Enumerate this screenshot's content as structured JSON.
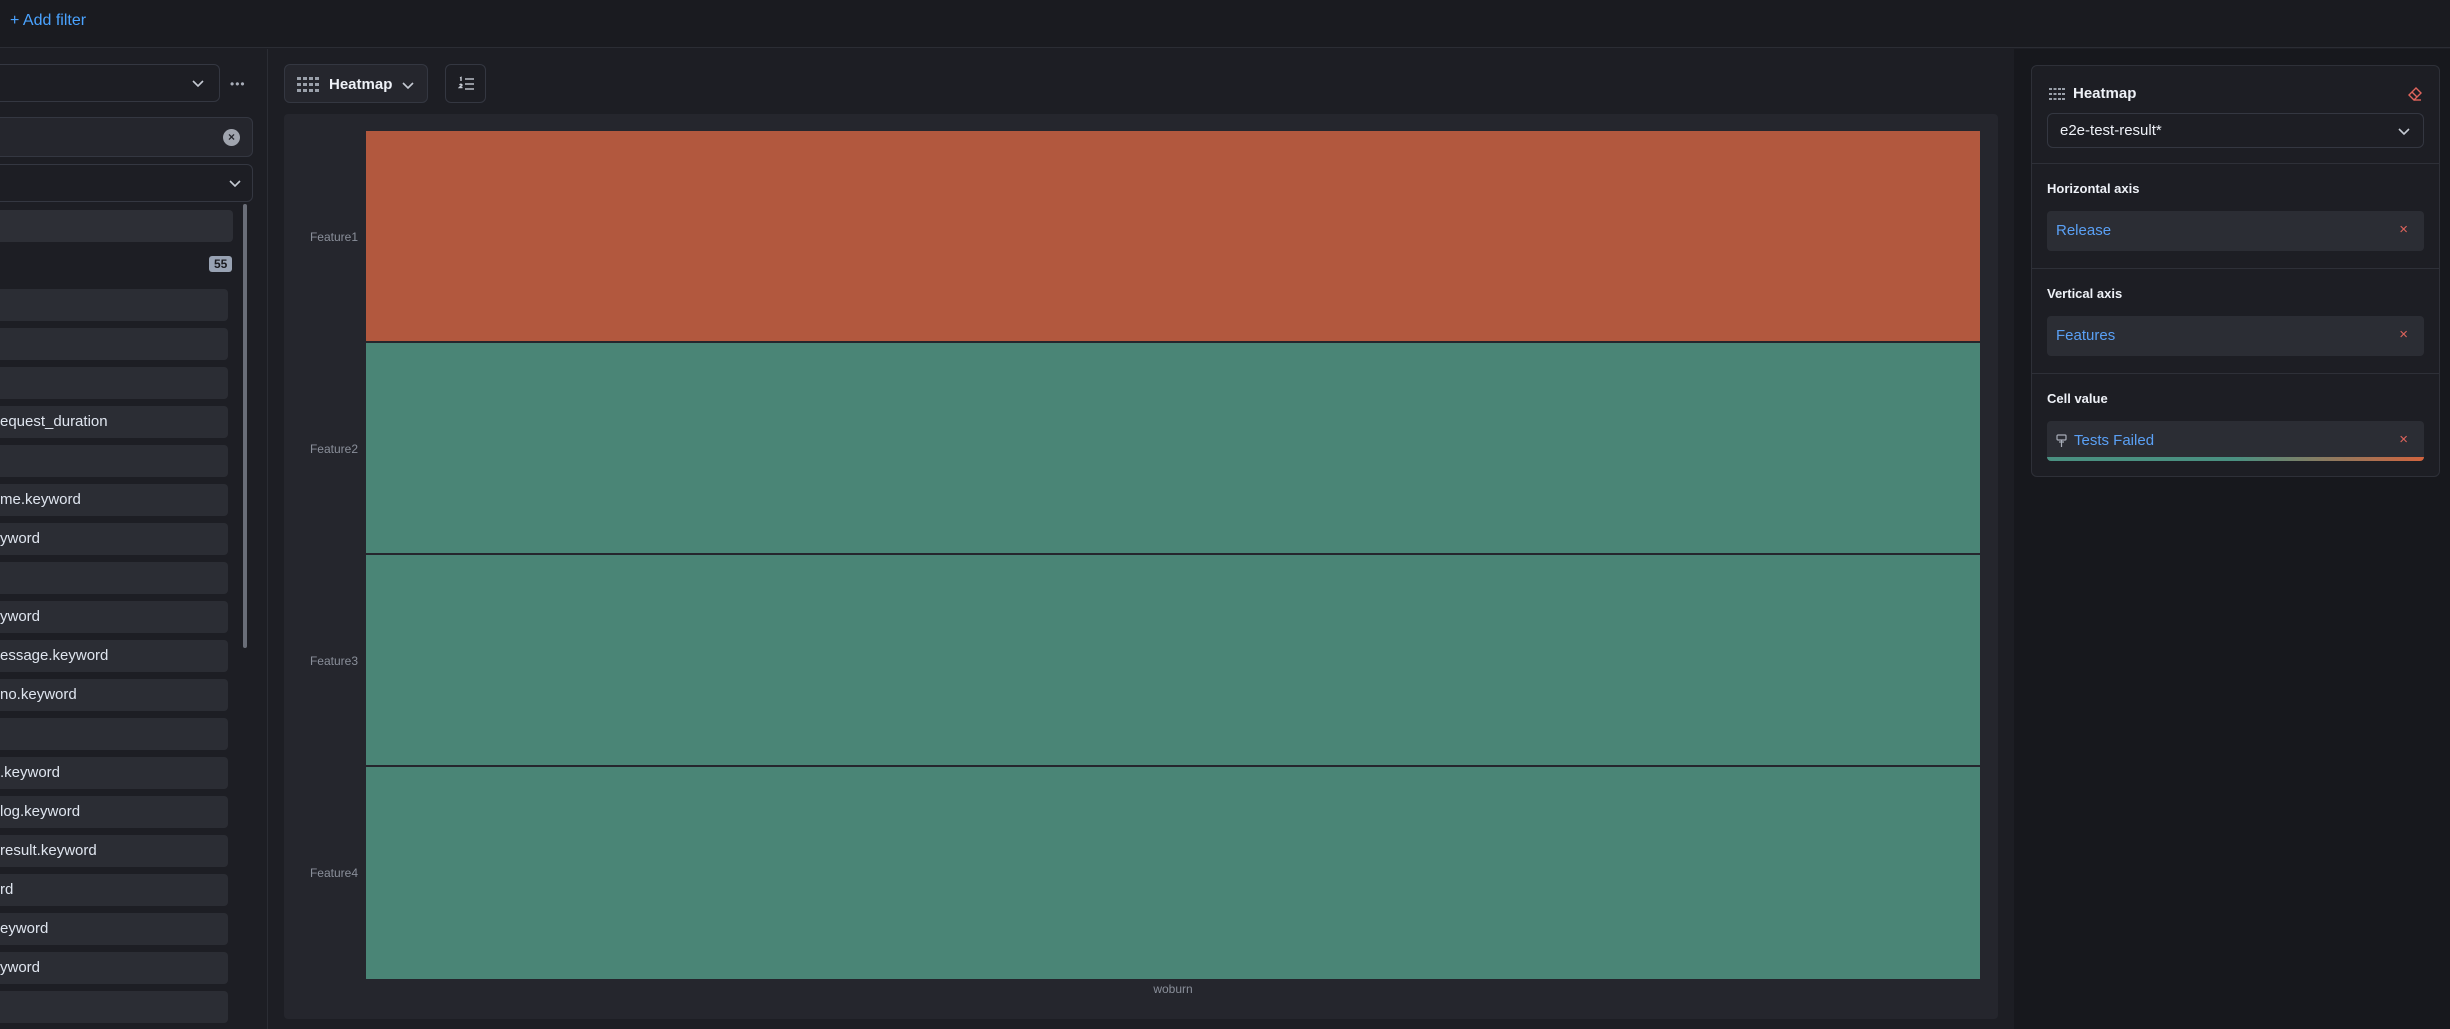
{
  "topbar": {
    "add_filter": "+ Add filter"
  },
  "sidebar": {
    "more": "•••",
    "count": "55",
    "fields": [
      "",
      "",
      "",
      "equest_duration",
      "",
      "me.keyword",
      "yword",
      "",
      "yword",
      "essage.keyword",
      "no.keyword",
      "",
      ".keyword",
      "log.keyword",
      "result.keyword",
      "rd",
      "eyword",
      "yword",
      ""
    ]
  },
  "main": {
    "chart_type": "Heatmap",
    "x_axis_label": "woburn"
  },
  "chart_data": {
    "type": "heatmap",
    "x_categories": [
      "woburn"
    ],
    "y_categories": [
      "Feature1",
      "Feature2",
      "Feature3",
      "Feature4"
    ],
    "cells": [
      {
        "y": "Feature1",
        "x": "woburn",
        "color": "#b2583e",
        "level": "high"
      },
      {
        "y": "Feature2",
        "x": "woburn",
        "color": "#4a8576",
        "level": "low"
      },
      {
        "y": "Feature3",
        "x": "woburn",
        "color": "#4a8576",
        "level": "low"
      },
      {
        "y": "Feature4",
        "x": "woburn",
        "color": "#4a8576",
        "level": "low"
      }
    ],
    "palette": [
      "#4a9081",
      "#d2643e"
    ]
  },
  "config": {
    "title": "Heatmap",
    "index_pattern": "e2e-test-result*",
    "horizontal_axis_title": "Horizontal axis",
    "horizontal_axis_value": "Release",
    "vertical_axis_title": "Vertical axis",
    "vertical_axis_value": "Features",
    "cell_value_title": "Cell value",
    "cell_value": "Tests Failed",
    "remove": "×"
  },
  "colors": {
    "accent": "#4aa3ff",
    "remove": "#e0645c",
    "bg": "#1d1e24"
  }
}
